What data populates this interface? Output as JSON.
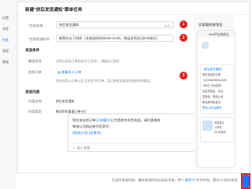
{
  "nav": {
    "items": [
      "设置",
      "消息",
      "任务",
      "管理",
      "数据"
    ]
  },
  "page": {
    "title": "新建\"拼后发货通知\"跟单任务"
  },
  "sections": {
    "basic": "基本信息",
    "trigger": "发送条件",
    "content": "发送内容"
  },
  "form": {
    "task_name_label": "任务名称",
    "task_name_value": "拼后发货通知",
    "task_name_count": "6/30",
    "task_time_label": "任务发送时间",
    "task_time_value": "推荐在以下时间（非发送时间00:00~21:00，则延迟到次日9:00执行）",
    "trigger_label": "触发条件",
    "trigger_value": "买家与实际订单状态为\"已发货\"，需要自己发货",
    "filter_label": "选择订单",
    "filter_link": "查看导入订单",
    "filter_hint": "仅针对导入订单以及\"已发货\"的订单，且订单包含满足所选条件的商品",
    "content_label": "内容名称",
    "content_value": "拼后发货通知",
    "content_type_label": "内容类型",
    "content_type_value": "推送到本渠道订单卡片"
  },
  "message": {
    "line1_a": "您在本店的订单",
    "line1_var": "{订单编号}",
    "line1_b": "已为您拼合发货发出，请注意查收",
    "line2": "物流公司和运单号信息为：",
    "line3": "{物流公司}-{运单号}",
    "insert_label": "插入变量"
  },
  "badges": [
    "1",
    "2",
    "3",
    "4"
  ],
  "preview": {
    "title": "买家端效果预览",
    "shop": "Mini拼宝旗舰店",
    "bubble": [
      "【拼后发货通知】",
      "您在本店的订单",
      "【123456789012345",
      "7890】已为您拼",
      "合发货发出，请注",
      "意查收，物流公司",
      "和运单号信息为：",
      "物流公司-运单号"
    ],
    "card": [
      "亲密宝贝",
      "订单号",
      "共1件商品"
    ]
  },
  "footer": {
    "text_a": "钉选为发送时间，最终发送时间以实际为准，将\"",
    "text_var": "+ 插件卡",
    "text_b": "\"作为补充，预计1小时内发送"
  },
  "colors": {
    "accent": "#1677ff",
    "badge": "#e02020"
  }
}
